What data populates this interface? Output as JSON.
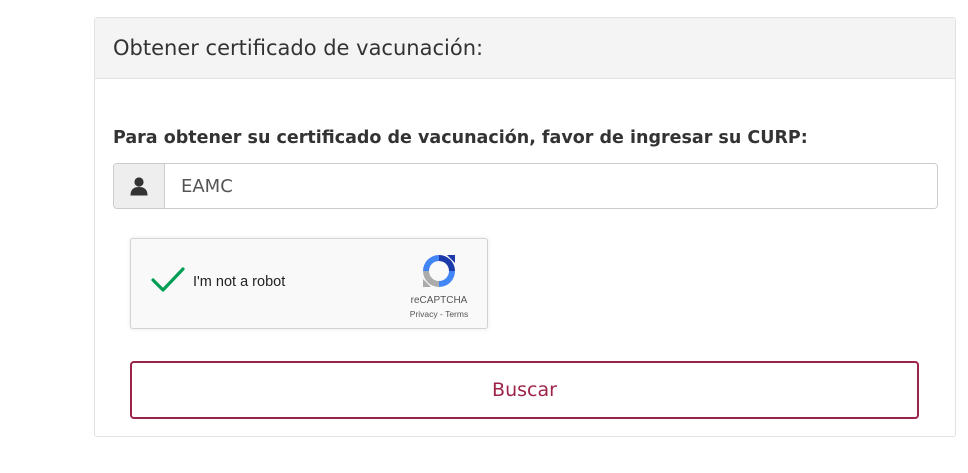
{
  "panel": {
    "title": "Obtener certificado de vacunación:",
    "instruction": "Para obtener su certificado de vacunación, favor de ingresar su CURP:"
  },
  "curp_input": {
    "value": "EAMC",
    "icon": "user-icon"
  },
  "recaptcha": {
    "label": "I'm not a robot",
    "checked": true,
    "brand": "reCAPTCHA",
    "privacy": "Privacy",
    "separator": " - ",
    "terms": "Terms"
  },
  "actions": {
    "search_label": "Buscar"
  },
  "colors": {
    "accent": "#9d2449",
    "check": "#009e55"
  }
}
